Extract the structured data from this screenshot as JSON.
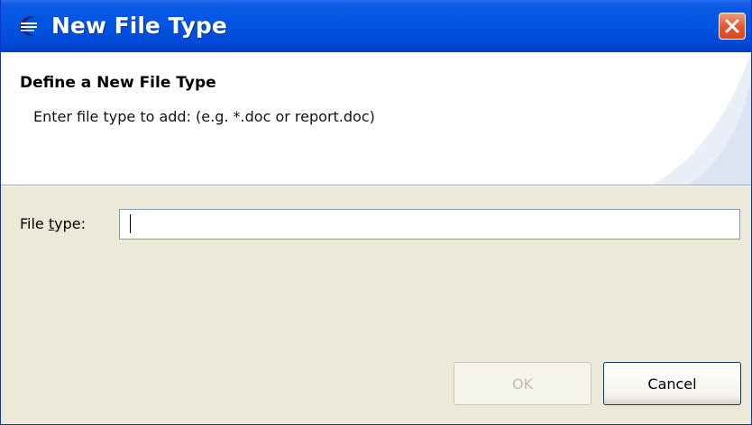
{
  "window": {
    "title": "New File Type",
    "app_icon": "eclipse-icon",
    "close_icon": "close-icon"
  },
  "banner": {
    "title": "Define a New File Type",
    "message": "Enter file type to add: (e.g. *.doc or report.doc)"
  },
  "form": {
    "label_prefix": "File ",
    "label_mnemonic": "t",
    "label_suffix": "ype:",
    "value": ""
  },
  "buttons": {
    "ok_label": "OK",
    "cancel_label": "Cancel"
  },
  "colors": {
    "titlebar": "#0053e1",
    "dialog_bg": "#ece9d8",
    "close_button": "#e3562c"
  }
}
